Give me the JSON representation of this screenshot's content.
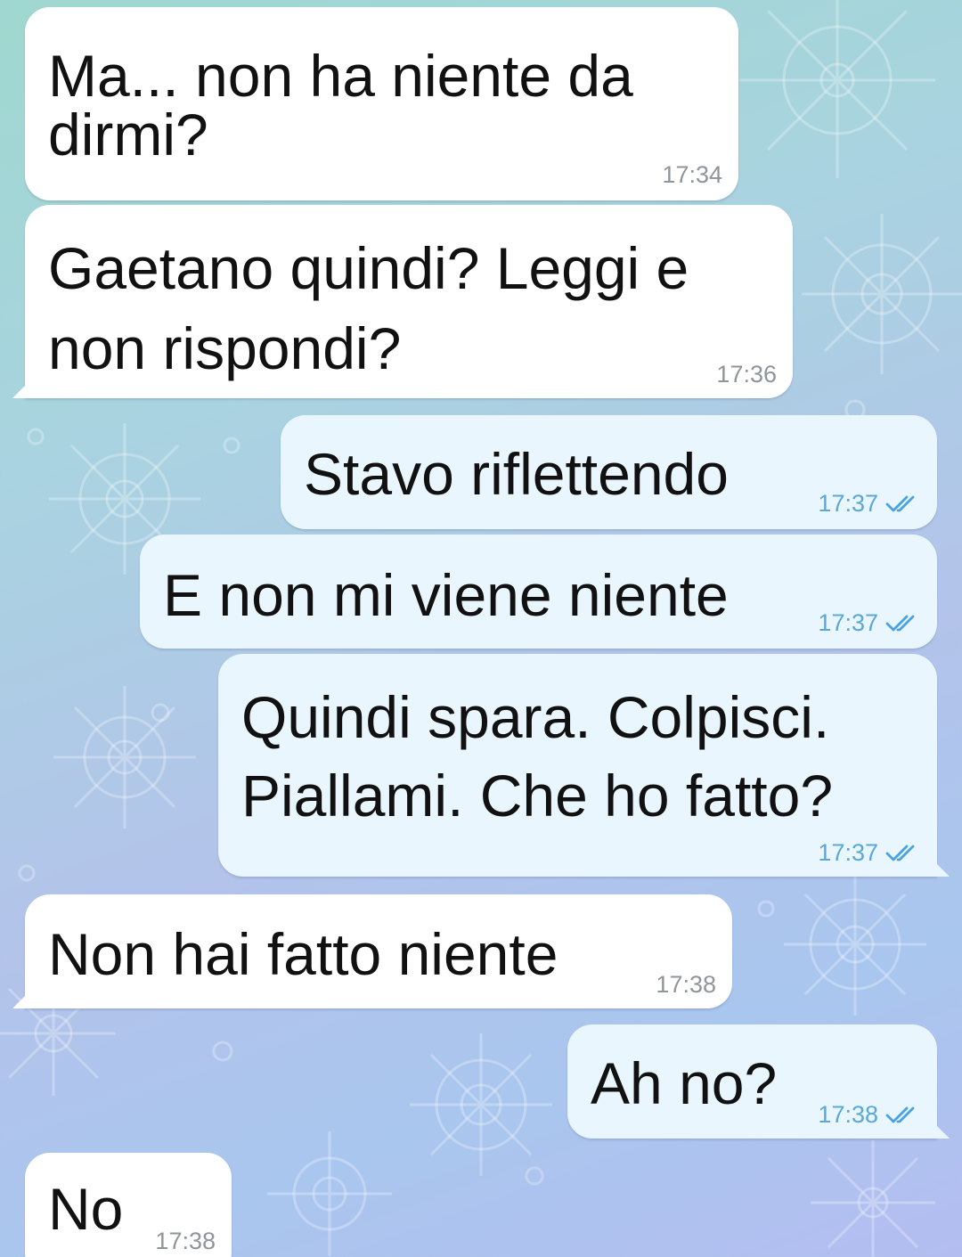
{
  "messages": [
    {
      "direction": "incoming",
      "lines": [
        "Ma... non ha niente da",
        "dirmi?"
      ],
      "time": "17:34"
    },
    {
      "direction": "incoming",
      "lines": [
        "Gaetano quindi? Leggi e",
        "non rispondi?"
      ],
      "time": "17:36"
    },
    {
      "direction": "outgoing",
      "lines": [
        "Stavo riflettendo"
      ],
      "time": "17:37",
      "status": "read"
    },
    {
      "direction": "outgoing",
      "lines": [
        "E non mi viene niente"
      ],
      "time": "17:37",
      "status": "read"
    },
    {
      "direction": "outgoing",
      "lines": [
        "Quindi spara. Colpisci.",
        "Piallami. Che ho fatto?"
      ],
      "time": "17:37",
      "status": "read"
    },
    {
      "direction": "incoming",
      "lines": [
        "Non hai fatto niente"
      ],
      "time": "17:38"
    },
    {
      "direction": "outgoing",
      "lines": [
        "Ah no?"
      ],
      "time": "17:38",
      "status": "read"
    },
    {
      "direction": "incoming",
      "lines": [
        "No"
      ],
      "time": "17:38"
    }
  ],
  "colors": {
    "incoming_bubble": "#ffffff",
    "outgoing_bubble": "#eaf6fe",
    "read_check": "#4aa3df"
  }
}
